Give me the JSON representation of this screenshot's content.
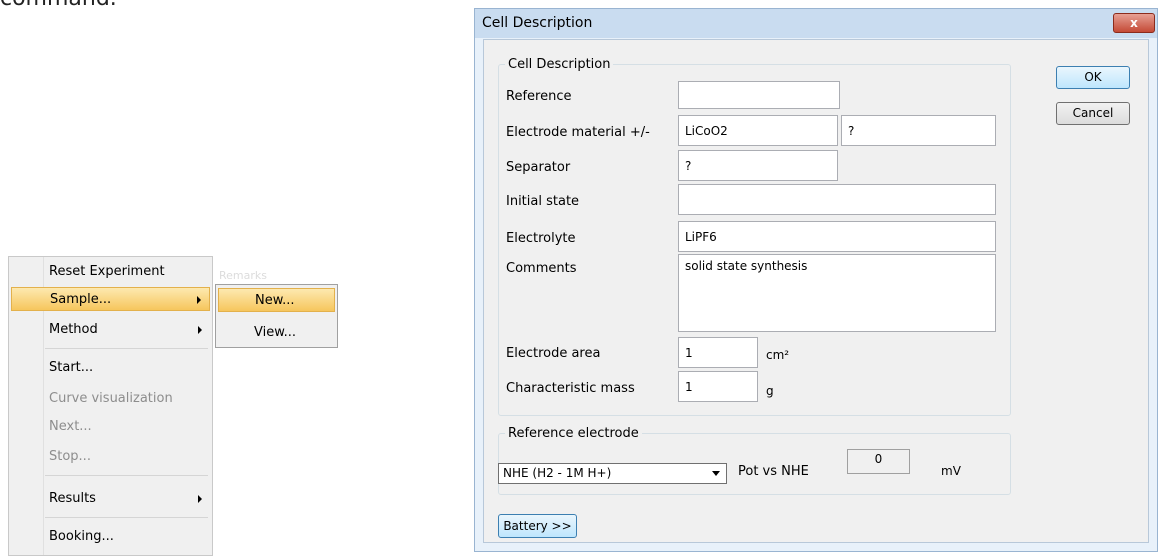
{
  "caption_fragment": "command.",
  "context_menu": {
    "items": [
      {
        "label": "Reset Experiment"
      },
      {
        "label": "Sample..."
      },
      {
        "label": "Method"
      },
      {
        "label": "Start..."
      },
      {
        "label": "Curve visualization"
      },
      {
        "label": "Next..."
      },
      {
        "label": "Stop..."
      },
      {
        "label": "Results"
      },
      {
        "label": "Booking..."
      }
    ],
    "ghost_text": "Remarks",
    "submenu": {
      "items": [
        {
          "label": "New..."
        },
        {
          "label": "View..."
        }
      ]
    }
  },
  "dialog": {
    "title": "Cell Description",
    "close_glyph": "x",
    "group_cell_label": "Cell Description",
    "fields": {
      "reference_label": "Reference",
      "reference_value": "",
      "electrode_material_label": "Electrode material +/-",
      "electrode_plus_value": "LiCoO2",
      "electrode_minus_value": "?",
      "separator_label": "Separator",
      "separator_value": "?",
      "initial_state_label": "Initial state",
      "initial_state_value": "",
      "electrolyte_label": "Electrolyte",
      "electrolyte_value": "LiPF6",
      "comments_label": "Comments",
      "comments_value": "solid state synthesis",
      "electrode_area_label": "Electrode area",
      "electrode_area_value": "1",
      "electrode_area_unit": "cm²",
      "char_mass_label": "Characteristic mass",
      "char_mass_value": "1",
      "char_mass_unit": "g"
    },
    "group_ref_label": "Reference electrode",
    "ref_electrode_selected": "NHE (H2  - 1M H+)",
    "pot_label": "Pot vs NHE",
    "pot_value": "0",
    "pot_unit": "mV",
    "ok_label": "OK",
    "cancel_label": "Cancel",
    "battery_label": "Battery >>"
  }
}
